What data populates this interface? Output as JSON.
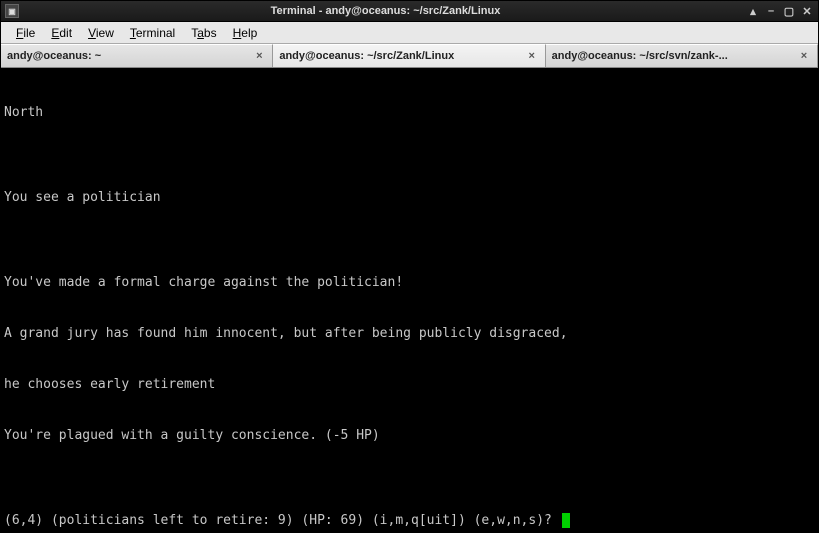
{
  "titlebar": {
    "title": "Terminal - andy@oceanus: ~/src/Zank/Linux"
  },
  "menubar": {
    "file": "File",
    "edit": "Edit",
    "view": "View",
    "terminal": "Terminal",
    "tabs": "Tabs",
    "help": "Help"
  },
  "tabs": [
    {
      "label": "andy@oceanus: ~",
      "active": false
    },
    {
      "label": "andy@oceanus: ~/src/Zank/Linux",
      "active": true
    },
    {
      "label": "andy@oceanus: ~/src/svn/zank-...",
      "active": false
    }
  ],
  "terminal": {
    "lines": [
      "North",
      "",
      "You see a politician",
      "",
      "You've made a formal charge against the politician!",
      "A grand jury has found him innocent, but after being publicly disgraced,",
      "he chooses early retirement",
      "You're plagued with a guilty conscience. (-5 HP)",
      "",
      "(6,4) (politicians left to retire: 9) (HP: 69) (i,m,q[uit]) (e,w,n,s)? "
    ]
  }
}
